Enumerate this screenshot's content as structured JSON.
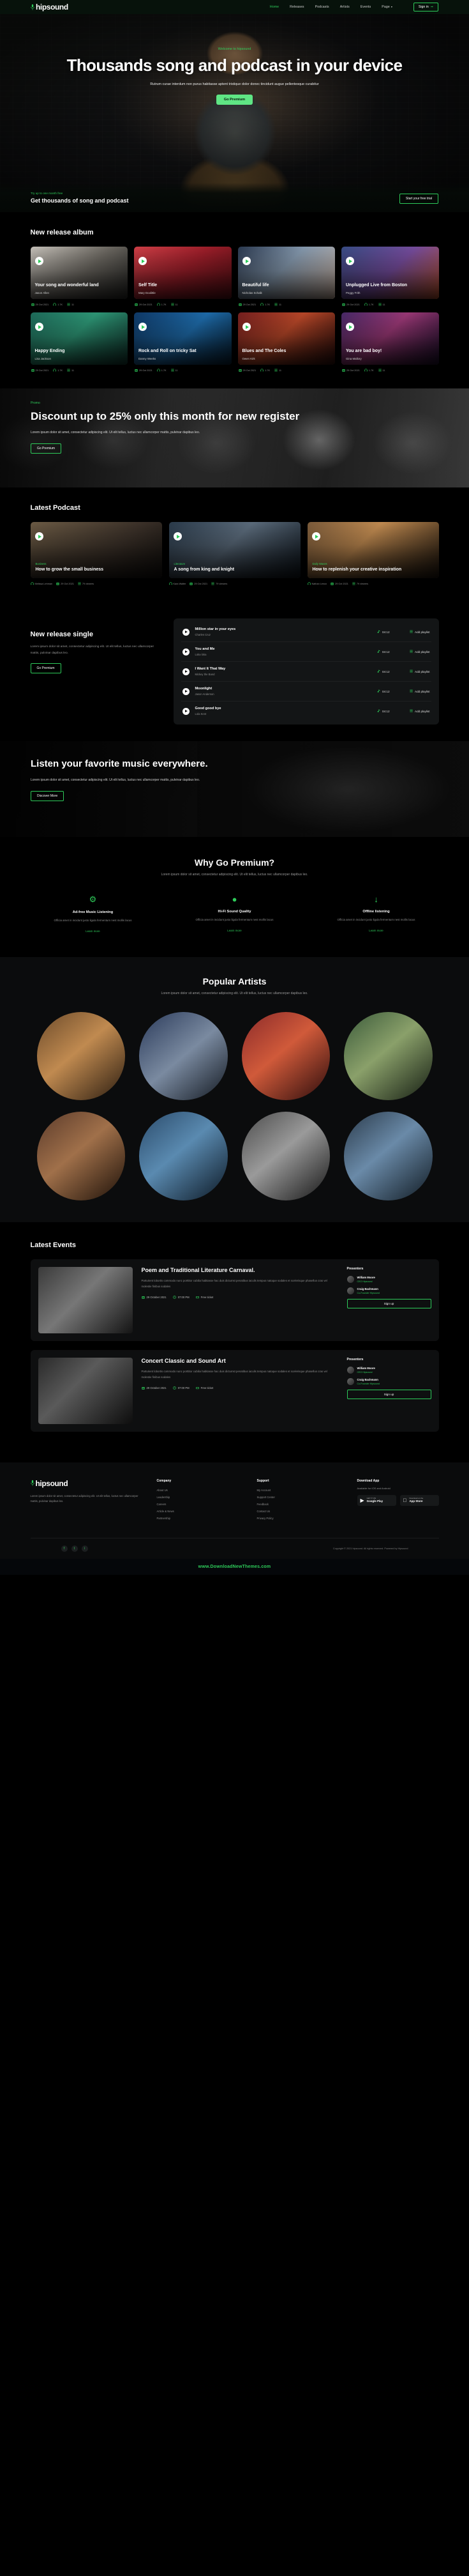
{
  "nav": {
    "brand": "hipsound",
    "brand_icon": "microphone-icon",
    "links": [
      {
        "label": "Home",
        "active": true
      },
      {
        "label": "Releases",
        "active": false
      },
      {
        "label": "Podcasts",
        "active": false
      },
      {
        "label": "Artists",
        "active": false
      },
      {
        "label": "Events",
        "active": false
      },
      {
        "label": "Page",
        "active": false,
        "caret": "▾"
      }
    ],
    "signin": "Sign in",
    "signin_icon": "login-arrow-icon"
  },
  "hero": {
    "eyebrow": "Welcome to hipsound",
    "title": "Thousands song and podcast in your device",
    "subtitle": "Rutrum curae interdum non purus habitasse aptent tristique dolor donec tincidunt augue pellentesque curabitur",
    "cta": "Go Premium",
    "bottom_tiny": "Try up to one month free",
    "bottom_big": "Get thousands of song and podcast",
    "bottom_cta": "Start your free trial"
  },
  "albums": {
    "title": "New release album",
    "items": [
      {
        "name": "Your song and wonderful land",
        "artist": "Jason Allen",
        "date": "29 Oct 2021",
        "plays": "1.7K",
        "tracks": "11",
        "art": "art1"
      },
      {
        "name": "Self Title",
        "artist": "Mary Doolittle",
        "date": "29 Oct 2021",
        "plays": "1.7K",
        "tracks": "11",
        "art": "art2"
      },
      {
        "name": "Beautiful life",
        "artist": "Nicholas Schalk",
        "date": "29 Oct 2021",
        "plays": "1.7K",
        "tracks": "11",
        "art": "art3"
      },
      {
        "name": "Unplugged Live from Boston",
        "artist": "Peggy Frith",
        "date": "29 Oct 2021",
        "plays": "1.7K",
        "tracks": "11",
        "art": "art4"
      },
      {
        "name": "Happy Ending",
        "artist": "Lisa Jackson",
        "date": "29 Oct 2021",
        "plays": "1.7K",
        "tracks": "11",
        "art": "art5"
      },
      {
        "name": "Rock and Roll on tricky Sat",
        "artist": "Danny Weeks",
        "date": "29 Oct 2021",
        "plays": "1.7K",
        "tracks": "11",
        "art": "art6"
      },
      {
        "name": "Blues and The Coles",
        "artist": "Owen Kirk",
        "date": "29 Oct 2021",
        "plays": "1.7K",
        "tracks": "11",
        "art": "art7"
      },
      {
        "name": "You are bad boy!",
        "artist": "Gina Mallory",
        "date": "29 Oct 2021",
        "plays": "1.7K",
        "tracks": "11",
        "art": "art8"
      }
    ]
  },
  "promo": {
    "tag": "Promo",
    "title": "Discount up to 25% only this month for new register",
    "text": "Lorem ipsum dolor sit amet, consectetur adipiscing elit. Ut elit tellus, luctus nec ullamcorper mattis, pulvinar dapibus leo.",
    "cta": "Go Premium"
  },
  "podcasts": {
    "title": "Latest Podcast",
    "items": [
      {
        "eyebrow": "Business",
        "name": "How to grow the small business",
        "author": "Melissa Lehman",
        "date": "29 Oct 2021",
        "views": "79 viewers",
        "art": "p1"
      },
      {
        "eyebrow": "Literature",
        "name": "A song from king and knight",
        "author": "Kara Walter",
        "date": "29 Oct 2021",
        "views": "79 viewers",
        "art": "p2"
      },
      {
        "eyebrow": "Daily Waves",
        "name": "How to replenish your creative inspiration",
        "author": "Nathan Lenox",
        "date": "29 Oct 2021",
        "views": "79 viewers",
        "art": "p3"
      }
    ]
  },
  "single": {
    "title": "New release single",
    "text": "Lorem ipsum dolor sit amet, consectetur adipiscing elit. Ut elit tellus, luctus nec ullamcorper mattis, pulvinar dapibus leo.",
    "cta": "Go Premium",
    "duration_label": "04:12",
    "add_label": "Add playlist",
    "tracks": [
      {
        "name": "Million star in your eyes",
        "artist": "Charles Cruz",
        "duration": "04:12",
        "add": "Add playlist"
      },
      {
        "name": "You and Me",
        "artist": "Loka loka",
        "duration": "04:12",
        "add": "Add playlist"
      },
      {
        "name": "I Want It That Way",
        "artist": "Mickey the Band",
        "duration": "04:12",
        "add": "Add playlist"
      },
      {
        "name": "Moonlight",
        "artist": "Jason Anderson",
        "duration": "04:12",
        "add": "Add playlist"
      },
      {
        "name": "Good good bye",
        "artist": "Lola Kent",
        "duration": "04:12",
        "add": "Add playlist"
      }
    ]
  },
  "listen": {
    "title": "Listen your favorite music everywhere.",
    "text": "Lorem ipsum dolor sit amet, consectetur adipiscing elit. Ut elit tellus, luctus nec ullamcorper mattis, pulvinar dapibus leo.",
    "cta": "Discover More"
  },
  "premium": {
    "title": "Why Go Premium?",
    "subtitle": "Lorem ipsum dolor sit amet, consectetur adipiscing elit. Ut elit tellus, luctus nec ullamcorper dapibus leo.",
    "features": [
      {
        "icon": "⚙",
        "icon_name": "gear-icon",
        "title": "Ad-free Music Listening",
        "text": "Officia amet in incidunt justo ligula fermentum nest mollis lacus",
        "link": "Learn more"
      },
      {
        "icon": "●",
        "icon_name": "sound-quality-icon",
        "title": "Hi-Fi Sound Quality",
        "text": "Officia amet in incidunt justo ligula fermentum nest mollis lacus",
        "link": "Learn more"
      },
      {
        "icon": "↓",
        "icon_name": "download-icon",
        "title": "Offline listening",
        "text": "Officia amet in incidunt justo ligula fermentum nest mollis lacus",
        "link": "Learn more"
      }
    ]
  },
  "artists": {
    "title": "Popular Artists",
    "subtitle": "Lorem ipsum dolor sit amet, consectetur adipiscing elit. Ut elit tellus, luctus nec ullamcorper dapibus leo.",
    "items": [
      {
        "art": "a1"
      },
      {
        "art": "a2"
      },
      {
        "art": "a3"
      },
      {
        "art": "a4"
      },
      {
        "art": "a5"
      },
      {
        "art": "a6"
      },
      {
        "art": "a7"
      },
      {
        "art": "a8"
      }
    ]
  },
  "events": {
    "title": "Latest Events",
    "presenters_label": "Presenters",
    "items": [
      {
        "art": "e1",
        "name": "Poem and Traditional Literature Carnaval.",
        "text": "Parturient lobortis commodo nunc porttitor cubilia habitasse hac duis dictumst penatibus iaculis tempus natoque sodales et scelerisque phasellus cras vel molestie finibus sodales",
        "date": "29 October 2021",
        "time": "07:00 PM",
        "price": "Free ticket",
        "signup": "Sign up",
        "presenters": [
          {
            "name": "William Moore",
            "role": "CEO Hipsound"
          },
          {
            "name": "Craig Bachmann",
            "role": "Co-Founder Hipsound"
          }
        ]
      },
      {
        "art": "e2",
        "name": "Concert Classic and Sound Art",
        "text": "Parturient lobortis commodo nunc porttitor cubilia habitasse hac duis dictumst penatibus iaculis tempus natoque sodales et scelerisque phasellus cras vel molestie finibus sodales",
        "date": "29 October 2021",
        "time": "07:00 PM",
        "price": "Free ticket",
        "signup": "Sign up",
        "presenters": [
          {
            "name": "William Moore",
            "role": "CEO Hipsound"
          },
          {
            "name": "Craig Bachmann",
            "role": "Co-Founder Hipsound"
          }
        ]
      }
    ]
  },
  "footer": {
    "brand": "hipsound",
    "about": "Lorem ipsum dolor sit amet, consectetur adipiscing elit. Ut elit tellus, luctus nec ullamcorper mattis, pulvinar dapibus leo.",
    "columns": [
      {
        "title": "Company",
        "items": [
          "About Us",
          "Leadership",
          "Careers",
          "Article & News",
          "Partnership"
        ]
      },
      {
        "title": "Support",
        "items": [
          "My Account",
          "Support Center",
          "Feedback",
          "Contact Us",
          "Privacy Policy"
        ]
      }
    ],
    "app": {
      "title": "Download App",
      "sub": "Available for iOS and Android",
      "stores": [
        {
          "icon": "▶",
          "icon_name": "google-play-icon",
          "small": "GET IT ON",
          "big": "Google Play"
        },
        {
          "icon": "",
          "icon_name": "apple-icon",
          "small": "Download on the",
          "big": "App Store"
        }
      ]
    },
    "socials": [
      "f",
      "t",
      "i"
    ],
    "copyright": "Copyright © 2021 hipsound. All rights reserved. Powered by Hipsound"
  },
  "ribbon": "www.DownloadNewThemes.com"
}
